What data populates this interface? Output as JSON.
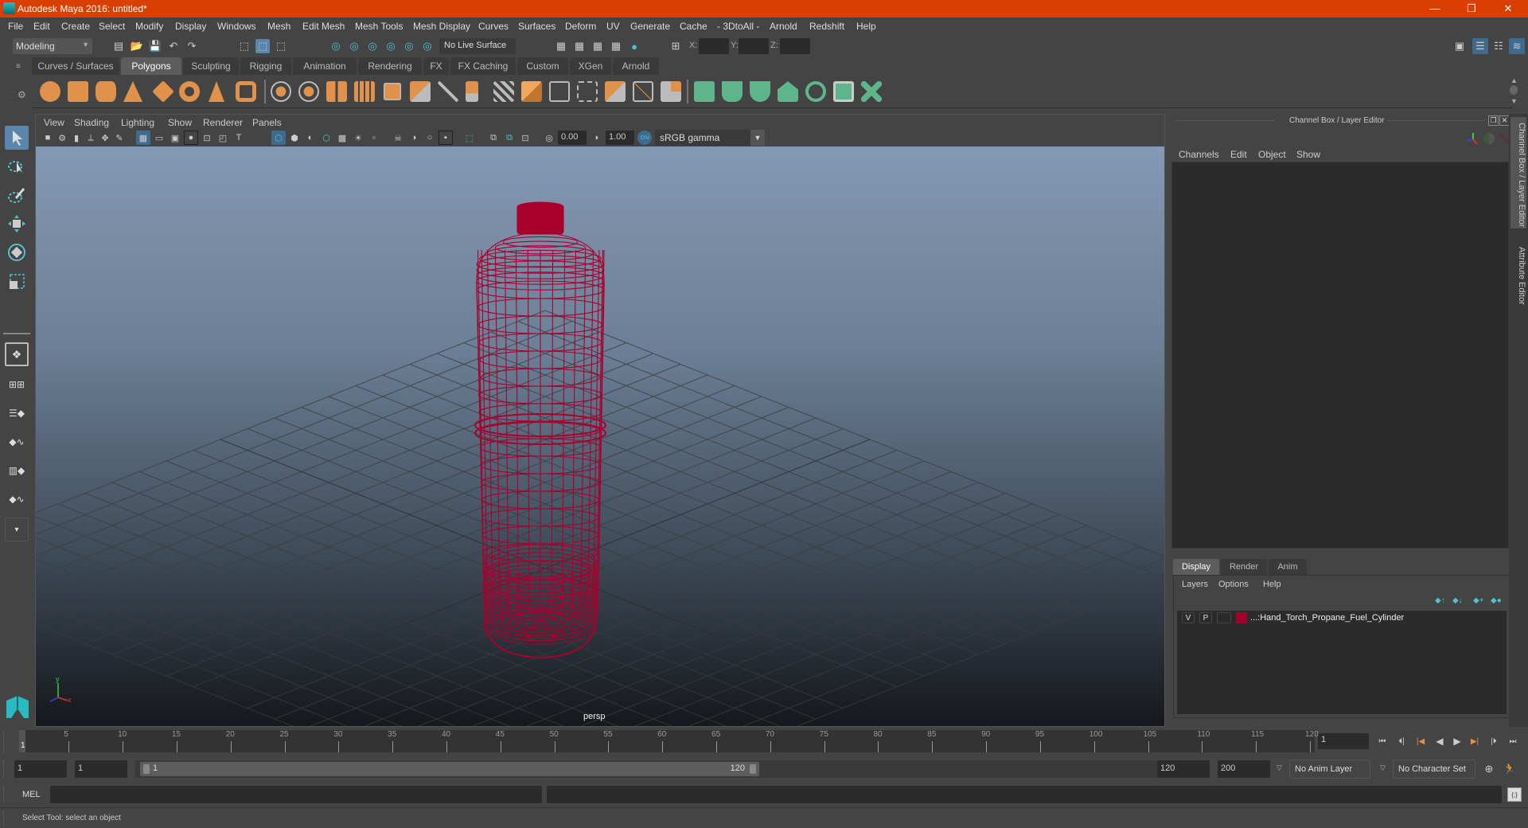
{
  "window": {
    "title": "Autodesk Maya 2016: untitled*",
    "controls": {
      "minimize": "—",
      "restore": "❐",
      "close": "✕"
    }
  },
  "menubar": [
    "File",
    "Edit",
    "Create",
    "Select",
    "Modify",
    "Display",
    "Windows",
    "Mesh",
    "Edit Mesh",
    "Mesh Tools",
    "Mesh Display",
    "Curves",
    "Surfaces",
    "Deform",
    "UV",
    "Generate",
    "Cache",
    "- 3DtoAll -",
    "Arnold",
    "Redshift",
    "Help"
  ],
  "status_line": {
    "menuset": "Modeling",
    "live_surface": "No Live Surface",
    "x_label": "X:",
    "y_label": "Y:",
    "z_label": "Z:",
    "x_value": "",
    "y_value": "",
    "z_value": ""
  },
  "shelf_tabs": [
    {
      "label": "Curves / Surfaces",
      "active": false
    },
    {
      "label": "Polygons",
      "active": true
    },
    {
      "label": "Sculpting",
      "active": false
    },
    {
      "label": "Rigging",
      "active": false
    },
    {
      "label": "Animation",
      "active": false
    },
    {
      "label": "Rendering",
      "active": false
    },
    {
      "label": "FX",
      "active": false
    },
    {
      "label": "FX Caching",
      "active": false
    },
    {
      "label": "Custom",
      "active": false
    },
    {
      "label": "XGen",
      "active": false
    },
    {
      "label": "Arnold",
      "active": false
    }
  ],
  "shelf_icons": [
    "poly-sphere",
    "poly-cube",
    "poly-cylinder",
    "poly-cone",
    "poly-diamond",
    "poly-torus",
    "poly-pyramid",
    "poly-pipe",
    "combine",
    "separate",
    "mirror",
    "smooth",
    "extract",
    "bevel",
    "bridge",
    "multi-cut",
    "extrude",
    "insert-edge-loop",
    "append-polygon",
    "fill-hole",
    "target-weld",
    "bridge-edge",
    "quad-draw",
    "sew-uv",
    "planar-map",
    "cylindrical-map",
    "spherical-map",
    "automatic-map",
    "unfold",
    "uv-editor",
    "cut-uv"
  ],
  "viewport": {
    "menu": [
      "View",
      "Shading",
      "Lighting",
      "Show",
      "Renderer",
      "Panels"
    ],
    "exposure": "0.00",
    "gamma": "1.00",
    "color_space": "sRGB gamma",
    "camera_label": "persp",
    "object_color": "#a8002e"
  },
  "channel_box": {
    "title": "Channel Box / Layer Editor",
    "menu": [
      "Channels",
      "Edit",
      "Object",
      "Show"
    ]
  },
  "layer_editor": {
    "tabs": [
      {
        "label": "Display",
        "active": true
      },
      {
        "label": "Render",
        "active": false
      },
      {
        "label": "Anim",
        "active": false
      }
    ],
    "menu": [
      "Layers",
      "Options",
      "Help"
    ],
    "layers": [
      {
        "visible": "V",
        "playback": "P",
        "color": "#a0002e",
        "name": "...:Hand_Torch_Propane_Fuel_Cylinder"
      }
    ]
  },
  "side_tabs": [
    "Channel Box / Layer Editor",
    "Attribute Editor"
  ],
  "timeline": {
    "ticks": [
      "5",
      "10",
      "15",
      "20",
      "25",
      "30",
      "35",
      "40",
      "45",
      "50",
      "55",
      "60",
      "65",
      "70",
      "75",
      "80",
      "85",
      "90",
      "95",
      "100",
      "105",
      "110",
      "115",
      "120"
    ],
    "current_frame_marker": "1",
    "current_frame": "1"
  },
  "range": {
    "start": "1",
    "anim_start": "1",
    "slider_start": "1",
    "slider_end": "120",
    "anim_end": "120",
    "end": "200",
    "anim_layer": "No Anim Layer",
    "character_set": "No Character Set"
  },
  "command_line": {
    "label": "MEL",
    "value": ""
  },
  "status": {
    "help_text": "Select Tool: select an object"
  }
}
